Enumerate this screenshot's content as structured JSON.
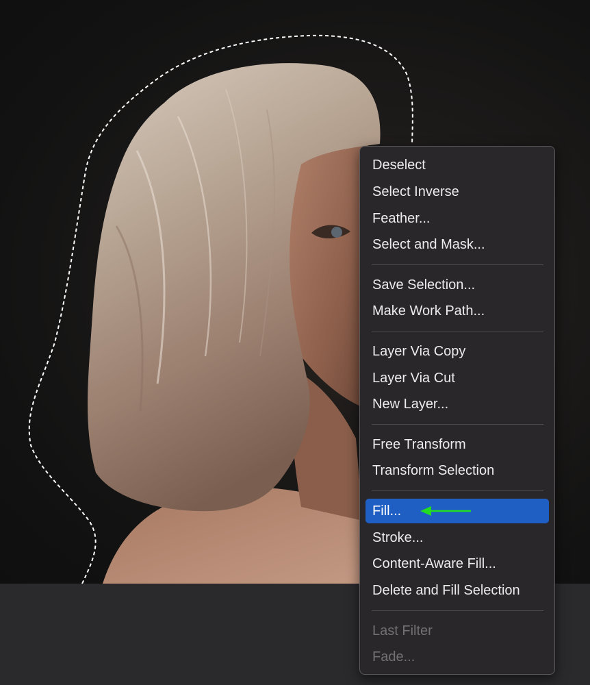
{
  "context_menu": {
    "groups": [
      [
        "Deselect",
        "Select Inverse",
        "Feather...",
        "Select and Mask..."
      ],
      [
        "Save Selection...",
        "Make Work Path..."
      ],
      [
        "Layer Via Copy",
        "Layer Via Cut",
        "New Layer..."
      ],
      [
        "Free Transform",
        "Transform Selection"
      ],
      [
        "Fill...",
        "Stroke...",
        "Content-Aware Fill...",
        "Delete and Fill Selection"
      ],
      [
        "Last Filter",
        "Fade..."
      ]
    ],
    "highlighted_item": "Fill...",
    "disabled_items": [
      "Last Filter",
      "Fade..."
    ]
  },
  "annotation": {
    "arrow_color": "#22dd22",
    "arrow_icon": "green-pointer-arrow-icon"
  },
  "colors": {
    "highlight": "#1f5fc4",
    "menu_background": "#29272a",
    "selection_marquee": "#ffffff"
  }
}
